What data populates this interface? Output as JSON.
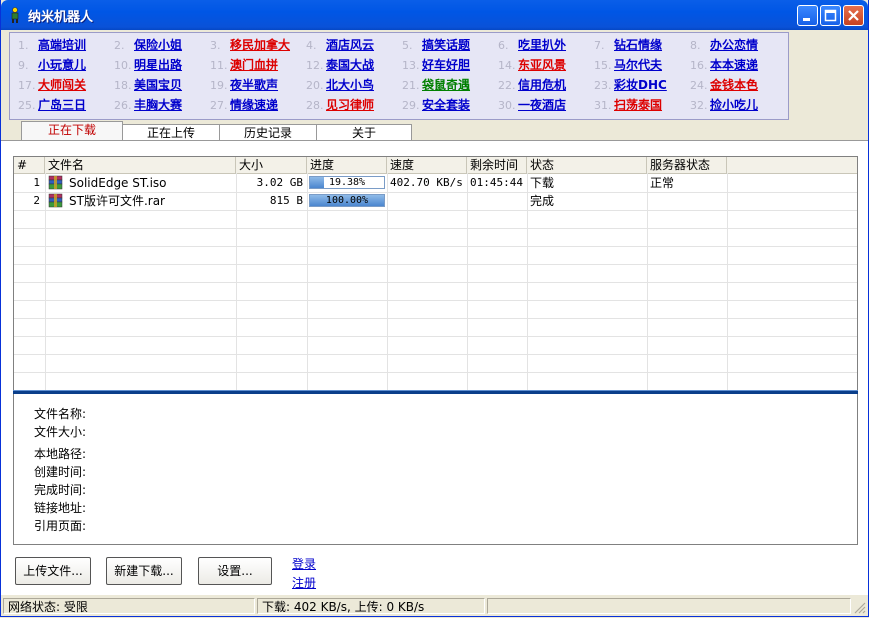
{
  "window": {
    "title": "纳米机器人"
  },
  "links": [
    {
      "num": "1.",
      "text": "高端培训",
      "color": "#0000cc"
    },
    {
      "num": "2.",
      "text": "保险小姐",
      "color": "#0000cc"
    },
    {
      "num": "3.",
      "text": "移民加拿大",
      "color": "#dd0000"
    },
    {
      "num": "4.",
      "text": "酒店风云",
      "color": "#0000cc"
    },
    {
      "num": "5.",
      "text": "搞笑话题",
      "color": "#0000cc"
    },
    {
      "num": "6.",
      "text": "吃里扒外",
      "color": "#0000cc"
    },
    {
      "num": "7.",
      "text": "钻石情缘",
      "color": "#0000cc"
    },
    {
      "num": "8.",
      "text": "办公恋情",
      "color": "#0000cc"
    },
    {
      "num": "9.",
      "text": "小玩意儿",
      "color": "#0000cc"
    },
    {
      "num": "10.",
      "text": "明星出路",
      "color": "#0000cc"
    },
    {
      "num": "11.",
      "text": "澳门血拼",
      "color": "#dd0000"
    },
    {
      "num": "12.",
      "text": "泰国大战",
      "color": "#0000cc"
    },
    {
      "num": "13.",
      "text": "好车好胆",
      "color": "#0000cc"
    },
    {
      "num": "14.",
      "text": "东亚风景",
      "color": "#dd0000"
    },
    {
      "num": "15.",
      "text": "马尔代夫",
      "color": "#0000cc"
    },
    {
      "num": "16.",
      "text": "本本速递",
      "color": "#0000cc"
    },
    {
      "num": "17.",
      "text": "大师闯关",
      "color": "#dd0000"
    },
    {
      "num": "18.",
      "text": "美国宝贝",
      "color": "#0000cc"
    },
    {
      "num": "19.",
      "text": "夜半歌声",
      "color": "#0000cc"
    },
    {
      "num": "20.",
      "text": "北大小鸟",
      "color": "#0000cc"
    },
    {
      "num": "21.",
      "text": "袋鼠奇遇",
      "color": "#008000"
    },
    {
      "num": "22.",
      "text": "信用危机",
      "color": "#0000cc"
    },
    {
      "num": "23.",
      "text": "彩妆DHC",
      "color": "#0000cc"
    },
    {
      "num": "24.",
      "text": "金钱本色",
      "color": "#dd0000"
    },
    {
      "num": "25.",
      "text": "广岛三日",
      "color": "#0000cc"
    },
    {
      "num": "26.",
      "text": "丰胸大赛",
      "color": "#0000cc"
    },
    {
      "num": "27.",
      "text": "情缘速递",
      "color": "#0000cc"
    },
    {
      "num": "28.",
      "text": "见习律师",
      "color": "#dd0000"
    },
    {
      "num": "29.",
      "text": "安全套装",
      "color": "#0000cc"
    },
    {
      "num": "30.",
      "text": "一夜酒店",
      "color": "#0000cc"
    },
    {
      "num": "31.",
      "text": "扫荡泰国",
      "color": "#dd0000"
    },
    {
      "num": "32.",
      "text": "捡小吃儿",
      "color": "#0000cc"
    }
  ],
  "tabs": [
    {
      "label": "正在下载",
      "active": true
    },
    {
      "label": "正在上传",
      "active": false
    },
    {
      "label": "历史记录",
      "active": false
    },
    {
      "label": "关于",
      "active": false
    }
  ],
  "table": {
    "columns": [
      "#",
      "文件名",
      "大小",
      "进度",
      "速度",
      "剩余时间",
      "状态",
      "服务器状态"
    ],
    "rows": [
      {
        "index": "1",
        "file_icon": "rar-archive-icon",
        "name": "SolidEdge ST.iso",
        "size": "3.02 GB",
        "progress": 0.1938,
        "progress_text": "19.38%",
        "speed": "402.70 KB/s",
        "remaining": "01:45:44",
        "status": "下载",
        "server_status": "正常"
      },
      {
        "index": "2",
        "file_icon": "rar-archive-icon",
        "name": "ST版许可文件.rar",
        "size": "815 B",
        "progress": 1.0,
        "progress_text": "100.00%",
        "speed": "",
        "remaining": "",
        "status": "完成",
        "server_status": ""
      }
    ]
  },
  "details": {
    "labels": [
      "文件名称:",
      "文件大小:",
      "本地路径:",
      "创建时间:",
      "完成时间:",
      "链接地址:",
      "引用页面:"
    ]
  },
  "buttons": {
    "upload": "上传文件...",
    "new_download": "新建下载...",
    "settings": "设置..."
  },
  "auth_links": {
    "login": "登录",
    "register": "注册"
  },
  "status": {
    "network": "网络状态: 受限",
    "transfer": "下载: 402 KB/s, 上传: 0 KB/s",
    "extra": ""
  }
}
